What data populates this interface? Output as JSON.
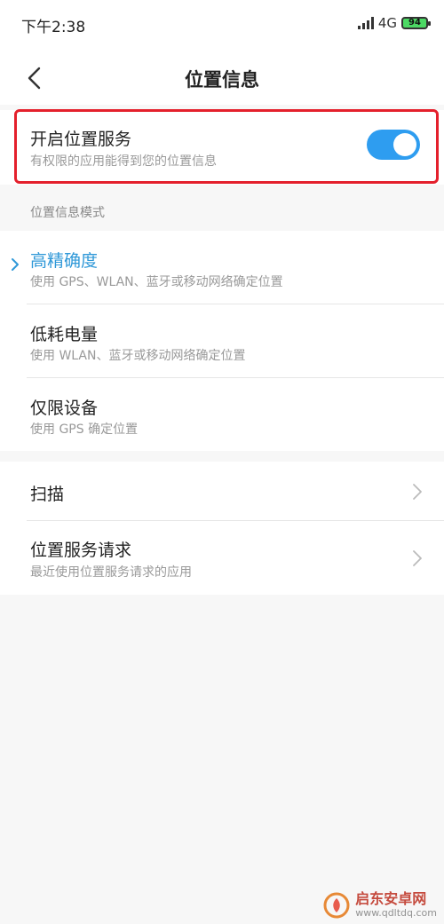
{
  "status_bar": {
    "time": "下午2:38",
    "network": "4G",
    "battery": "94"
  },
  "header": {
    "title": "位置信息"
  },
  "location_service": {
    "title": "开启位置服务",
    "subtitle": "有权限的应用能得到您的位置信息",
    "enabled": true
  },
  "mode_section": {
    "label": "位置信息模式",
    "modes": [
      {
        "title": "高精确度",
        "subtitle": "使用 GPS、WLAN、蓝牙或移动网络确定位置",
        "selected": true
      },
      {
        "title": "低耗电量",
        "subtitle": "使用 WLAN、蓝牙或移动网络确定位置",
        "selected": false
      },
      {
        "title": "仅限设备",
        "subtitle": "使用 GPS 确定位置",
        "selected": false
      }
    ]
  },
  "other_items": [
    {
      "title": "扫描",
      "subtitle": ""
    },
    {
      "title": "位置服务请求",
      "subtitle": "最近使用位置服务请求的应用"
    }
  ],
  "watermark": {
    "text": "启东安卓网",
    "url": "www.qdltdq.com"
  },
  "colors": {
    "accent": "#2e9df0",
    "selected_text": "#2f98d8",
    "highlight": "#e4202c"
  },
  "icons": {
    "back": "chevron-left-icon",
    "check": "chevron-right-small-icon",
    "item_arrow": "chevron-right-icon"
  }
}
